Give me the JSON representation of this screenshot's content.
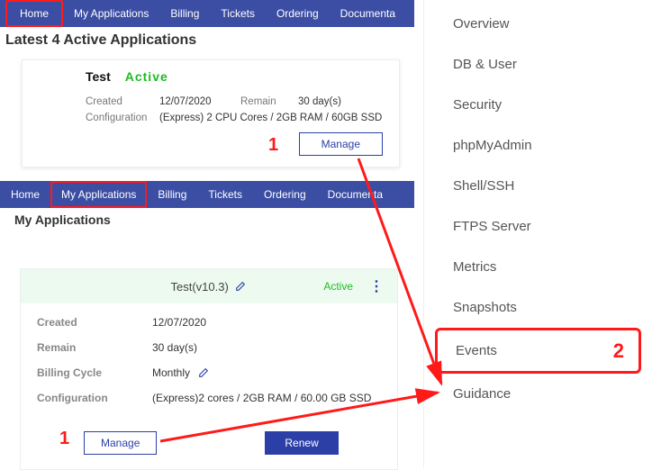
{
  "navA": {
    "home": "Home",
    "myapps": "My Applications",
    "billing": "Billing",
    "tickets": "Tickets",
    "ordering": "Ordering",
    "documentation": "Documenta"
  },
  "latest_title": "Latest 4 Active Applications",
  "cardA": {
    "name": "Test",
    "status": "Active",
    "created_lbl": "Created",
    "created_val": "12/07/2020",
    "remain_lbl": "Remain",
    "remain_val": "30 day(s)",
    "config_lbl": "Configuration",
    "config_val": "(Express) 2 CPU Cores / 2GB RAM / 60GB SSD",
    "manage": "Manage"
  },
  "navB": {
    "home": "Home",
    "myapps": "My Applications",
    "billing": "Billing",
    "tickets": "Tickets",
    "ordering": "Ordering",
    "documentation": "Documenta"
  },
  "myapps_title": "My Applications",
  "cardB": {
    "title": "Test(v10.3)",
    "status": "Active",
    "created_lbl": "Created",
    "created_val": "12/07/2020",
    "remain_lbl": "Remain",
    "remain_val": "30 day(s)",
    "billing_lbl": "Billing Cycle",
    "billing_val": "Monthly",
    "config_lbl": "Configuration",
    "config_val": "(Express)2 cores / 2GB RAM / 60.00 GB SSD",
    "manage": "Manage",
    "renew": "Renew"
  },
  "sidebar": {
    "items": [
      "Overview",
      "DB & User",
      "Security",
      "phpMyAdmin",
      "Shell/SSH",
      "FTPS Server",
      "Metrics",
      "Snapshots",
      "Events",
      "Guidance"
    ]
  },
  "annotations": {
    "one": "1",
    "two": "2"
  }
}
